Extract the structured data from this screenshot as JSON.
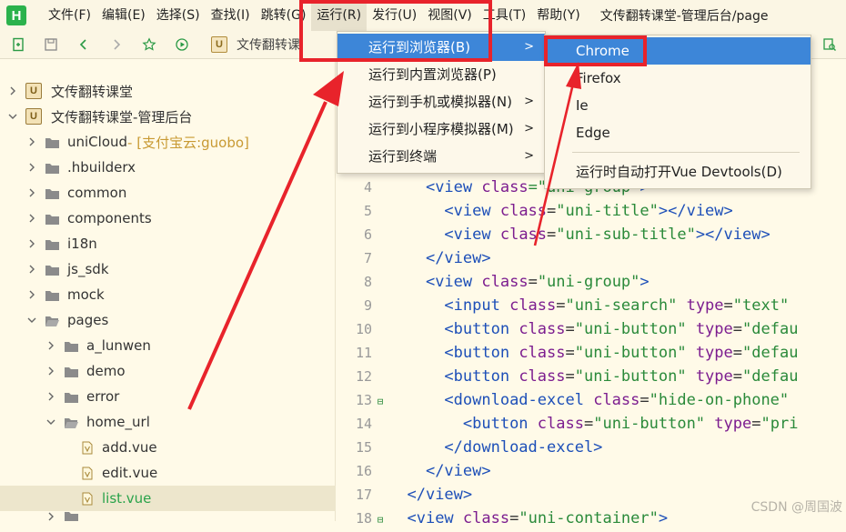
{
  "app": {
    "logo_text": "H",
    "window_title": "文传翻转课堂-管理后台/page"
  },
  "menubar": {
    "items": [
      "文件(F)",
      "编辑(E)",
      "选择(S)",
      "查找(I)",
      "跳转(G)",
      "运行(R)",
      "发行(U)",
      "视图(V)",
      "工具(T)",
      "帮助(Y)"
    ],
    "active": "运行(R)"
  },
  "toolbar": {
    "breadcrumb_badge": "U",
    "breadcrumb_text": "文传翻转课"
  },
  "sidebar": {
    "items": [
      {
        "label": "文传翻转课堂",
        "type": "project",
        "badge": "U"
      },
      {
        "label": "文传翻转课堂-管理后台",
        "type": "project",
        "badge": "U"
      },
      {
        "label": "uniCloud",
        "suffix": " - [支付宝云:guobo]",
        "type": "folder"
      },
      {
        "label": ".hbuilderx",
        "type": "folder"
      },
      {
        "label": "common",
        "type": "folder"
      },
      {
        "label": "components",
        "type": "folder"
      },
      {
        "label": "i18n",
        "type": "folder"
      },
      {
        "label": "js_sdk",
        "type": "folder"
      },
      {
        "label": "mock",
        "type": "folder"
      },
      {
        "label": "pages",
        "type": "folder"
      },
      {
        "label": "a_lunwen",
        "type": "folder"
      },
      {
        "label": "demo",
        "type": "folder"
      },
      {
        "label": "error",
        "type": "folder"
      },
      {
        "label": "home_url",
        "type": "folder"
      },
      {
        "label": "add.vue",
        "type": "file"
      },
      {
        "label": "edit.vue",
        "type": "file"
      },
      {
        "label": "list.vue",
        "type": "file",
        "selected": true
      }
    ]
  },
  "editor": {
    "lines": [
      {
        "n": "4",
        "code": [
          [
            "    ",
            "plain"
          ],
          [
            "<view ",
            "tag"
          ],
          [
            "class",
            "attr"
          ],
          [
            "=\"uni-group\"",
            "str"
          ],
          [
            ">",
            "tag"
          ]
        ]
      },
      {
        "n": "5",
        "code": [
          [
            "      ",
            "plain"
          ],
          [
            "<view ",
            "tag"
          ],
          [
            "class",
            "attr"
          ],
          [
            "=",
            "plain"
          ],
          [
            "\"uni-title\"",
            "str"
          ],
          [
            "></view>",
            "tag"
          ]
        ]
      },
      {
        "n": "6",
        "code": [
          [
            "      ",
            "plain"
          ],
          [
            "<view ",
            "tag"
          ],
          [
            "class",
            "attr"
          ],
          [
            "=",
            "plain"
          ],
          [
            "\"uni-sub-title\"",
            "str"
          ],
          [
            "></view>",
            "tag"
          ]
        ]
      },
      {
        "n": "7",
        "code": [
          [
            "    ",
            "plain"
          ],
          [
            "</view>",
            "tag"
          ]
        ]
      },
      {
        "n": "8",
        "code": [
          [
            "    ",
            "plain"
          ],
          [
            "<view ",
            "tag"
          ],
          [
            "class",
            "attr"
          ],
          [
            "=",
            "plain"
          ],
          [
            "\"uni-group\"",
            "str"
          ],
          [
            ">",
            "tag"
          ]
        ]
      },
      {
        "n": "9",
        "code": [
          [
            "      ",
            "plain"
          ],
          [
            "<input ",
            "tag"
          ],
          [
            "class",
            "attr"
          ],
          [
            "=",
            "plain"
          ],
          [
            "\"uni-search\" ",
            "str"
          ],
          [
            "type",
            "attr"
          ],
          [
            "=",
            "plain"
          ],
          [
            "\"text\"",
            "str"
          ]
        ]
      },
      {
        "n": "10",
        "code": [
          [
            "      ",
            "plain"
          ],
          [
            "<button ",
            "tag"
          ],
          [
            "class",
            "attr"
          ],
          [
            "=",
            "plain"
          ],
          [
            "\"uni-button\" ",
            "str"
          ],
          [
            "type",
            "attr"
          ],
          [
            "=",
            "plain"
          ],
          [
            "\"defau",
            "str"
          ]
        ]
      },
      {
        "n": "11",
        "code": [
          [
            "      ",
            "plain"
          ],
          [
            "<button ",
            "tag"
          ],
          [
            "class",
            "attr"
          ],
          [
            "=",
            "plain"
          ],
          [
            "\"uni-button\" ",
            "str"
          ],
          [
            "type",
            "attr"
          ],
          [
            "=",
            "plain"
          ],
          [
            "\"defau",
            "str"
          ]
        ]
      },
      {
        "n": "12",
        "code": [
          [
            "      ",
            "plain"
          ],
          [
            "<button ",
            "tag"
          ],
          [
            "class",
            "attr"
          ],
          [
            "=",
            "plain"
          ],
          [
            "\"uni-button\" ",
            "str"
          ],
          [
            "type",
            "attr"
          ],
          [
            "=",
            "plain"
          ],
          [
            "\"defau",
            "str"
          ]
        ]
      },
      {
        "n": "13",
        "fold": "⊟",
        "code": [
          [
            "      ",
            "plain"
          ],
          [
            "<download-excel ",
            "tag"
          ],
          [
            "class",
            "attr"
          ],
          [
            "=",
            "plain"
          ],
          [
            "\"hide-on-phone\"",
            "str"
          ]
        ]
      },
      {
        "n": "14",
        "code": [
          [
            "        ",
            "plain"
          ],
          [
            "<button ",
            "tag"
          ],
          [
            "class",
            "attr"
          ],
          [
            "=",
            "plain"
          ],
          [
            "\"uni-button\" ",
            "str"
          ],
          [
            "type",
            "attr"
          ],
          [
            "=",
            "plain"
          ],
          [
            "\"pri",
            "str"
          ]
        ]
      },
      {
        "n": "15",
        "code": [
          [
            "      ",
            "plain"
          ],
          [
            "</download-excel>",
            "tag"
          ]
        ]
      },
      {
        "n": "16",
        "code": [
          [
            "    ",
            "plain"
          ],
          [
            "</view>",
            "tag"
          ]
        ]
      },
      {
        "n": "17",
        "code": [
          [
            "  ",
            "plain"
          ],
          [
            "</view>",
            "tag"
          ]
        ]
      },
      {
        "n": "18",
        "fold": "⊟",
        "code": [
          [
            "  ",
            "plain"
          ],
          [
            "<view ",
            "tag"
          ],
          [
            "class",
            "attr"
          ],
          [
            "=",
            "plain"
          ],
          [
            "\"uni-container\"",
            "str"
          ],
          [
            ">",
            "tag"
          ]
        ]
      }
    ]
  },
  "run_menu": {
    "items": [
      {
        "label": "运行到浏览器(B)",
        "submenu": true,
        "hover": true
      },
      {
        "label": "运行到内置浏览器(P)",
        "submenu": false
      },
      {
        "label": "运行到手机或模拟器(N)",
        "submenu": true
      },
      {
        "label": "运行到小程序模拟器(M)",
        "submenu": true
      },
      {
        "label": "运行到终端",
        "submenu": true
      }
    ]
  },
  "browser_menu": {
    "items": [
      "Chrome",
      "Firefox",
      "Ie",
      "Edge"
    ],
    "hover": "Chrome",
    "extra": "运行时自动打开Vue Devtools(D)"
  },
  "watermark": "CSDN @周国波",
  "colors": {
    "annotation": "#e8232b",
    "menu_highlight": "#3d86d8",
    "logo": "#2bb24c"
  }
}
